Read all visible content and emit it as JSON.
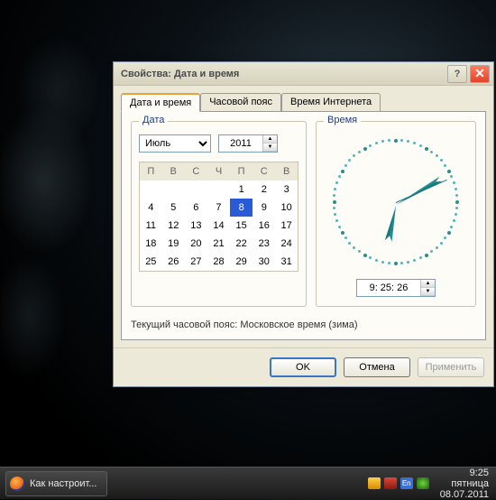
{
  "dialog": {
    "title": "Свойства: Дата и время",
    "tabs": [
      "Дата и время",
      "Часовой пояс",
      "Время Интернета"
    ],
    "date_group": "Дата",
    "time_group": "Время",
    "month": "Июль",
    "year": "2011",
    "weekdays": [
      "П",
      "В",
      "С",
      "Ч",
      "П",
      "С",
      "В"
    ],
    "days": [
      [
        "",
        "",
        "",
        "",
        "1",
        "2",
        "3"
      ],
      [
        "4",
        "5",
        "6",
        "7",
        "8",
        "9",
        "10"
      ],
      [
        "11",
        "12",
        "13",
        "14",
        "15",
        "16",
        "17"
      ],
      [
        "18",
        "19",
        "20",
        "21",
        "22",
        "23",
        "24"
      ],
      [
        "25",
        "26",
        "27",
        "28",
        "29",
        "30",
        "31"
      ]
    ],
    "selected_day": "8",
    "time_value": "9: 25: 26",
    "timezone_line": "Текущий часовой пояс: Московское время (зима)",
    "buttons": {
      "ok": "OK",
      "cancel": "Отмена",
      "apply": "Применить"
    }
  },
  "clock": {
    "hour_angle": 192,
    "minute_angle": 60,
    "second_angle": 66
  },
  "taskbar": {
    "task_label": "Как настроит...",
    "time": "9:25",
    "weekday": "пятница",
    "date": "08.07.2011",
    "lang": "En"
  }
}
